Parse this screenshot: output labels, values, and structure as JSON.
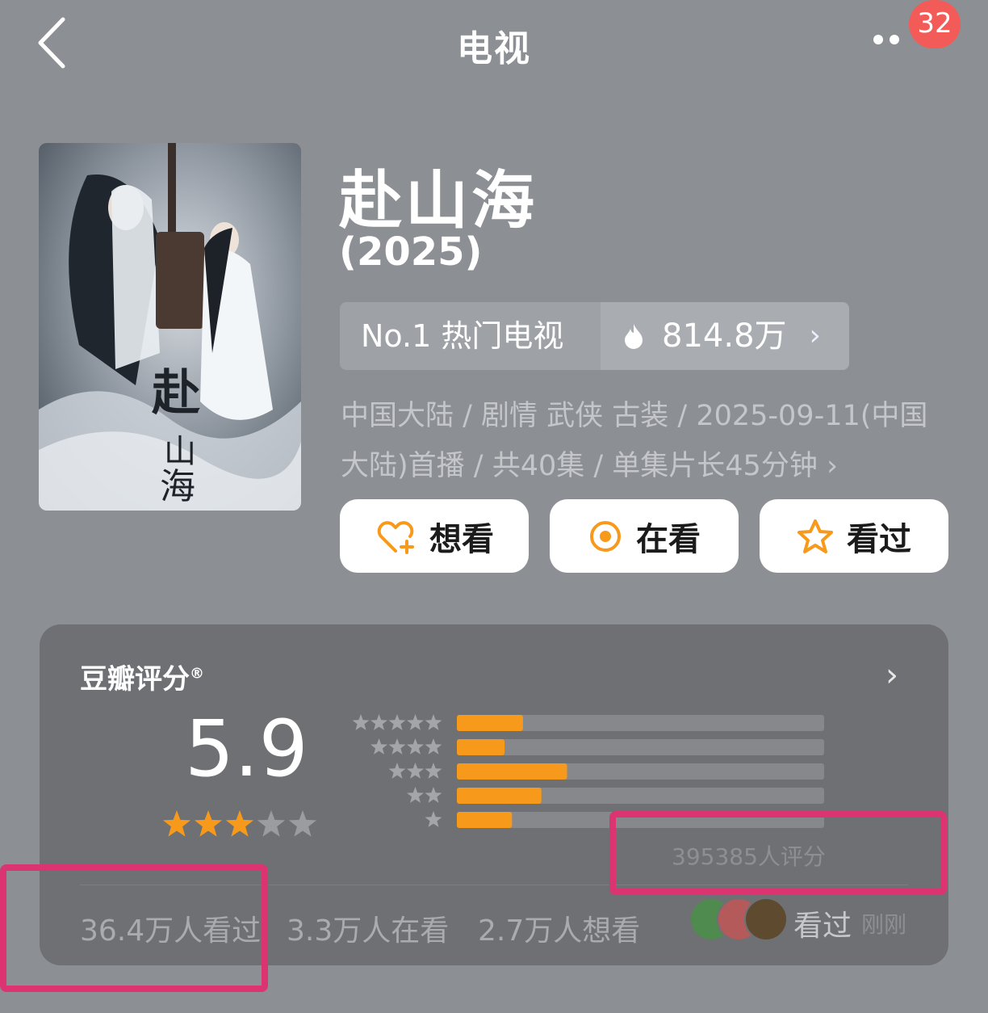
{
  "topbar": {
    "title": "电视",
    "badge": "32"
  },
  "show": {
    "title": "赴山海",
    "year": "(2025)"
  },
  "rank": {
    "label": "No.1 热门电视",
    "heat": "814.8万"
  },
  "info": {
    "line1": "中国大陆 / 剧情 武侠 古装 / 2025-09-11(中国",
    "line2": "大陆)首播 / 共40集 / 单集片长45分钟"
  },
  "actions": {
    "want": "想看",
    "watching": "在看",
    "watched": "看过"
  },
  "rating": {
    "title": "豆瓣评分",
    "reg": "®",
    "score": "5.9",
    "star_value": 3,
    "distribution": [
      {
        "stars": 5,
        "fraction": 0.18
      },
      {
        "stars": 4,
        "fraction": 0.13
      },
      {
        "stars": 3,
        "fraction": 0.3
      },
      {
        "stars": 2,
        "fraction": 0.23
      },
      {
        "stars": 1,
        "fraction": 0.15
      }
    ],
    "count": "395385人评分"
  },
  "stats": {
    "watched": "36.4万人看过",
    "watching": "3.3万人在看",
    "want": "2.7万人想看"
  },
  "activity": {
    "status": "看过",
    "time": "刚刚"
  },
  "colors": {
    "accent": "#f79a1b",
    "highlight": "#dc3470",
    "badge": "#f25b57"
  }
}
